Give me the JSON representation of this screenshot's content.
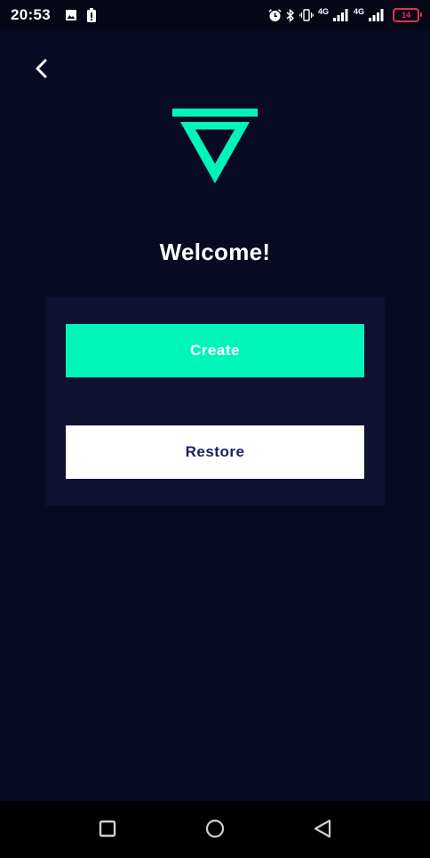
{
  "status_bar": {
    "time": "20:53",
    "net1": "4G",
    "net2": "4G",
    "battery": "14",
    "left_icons": [
      "image-icon",
      "battery-saver-icon"
    ],
    "right_icons": [
      "alarm-icon",
      "bluetooth-icon",
      "vibrate-icon",
      "signal-icon",
      "signal-icon",
      "battery-icon"
    ]
  },
  "header": {
    "back_icon": "chevron-left-icon"
  },
  "logo": {
    "name": "triangle-logo",
    "color": "#00f5b8"
  },
  "welcome": {
    "title": "Welcome!"
  },
  "actions": {
    "create_label": "Create",
    "restore_label": "Restore"
  },
  "colors": {
    "background": "#080a24",
    "panel": "#0e1130",
    "accent": "#00f5b8",
    "restore_text": "#1a1f5e"
  },
  "nav_bar": {
    "icons": [
      "recent-apps-icon",
      "home-icon",
      "back-icon"
    ]
  }
}
